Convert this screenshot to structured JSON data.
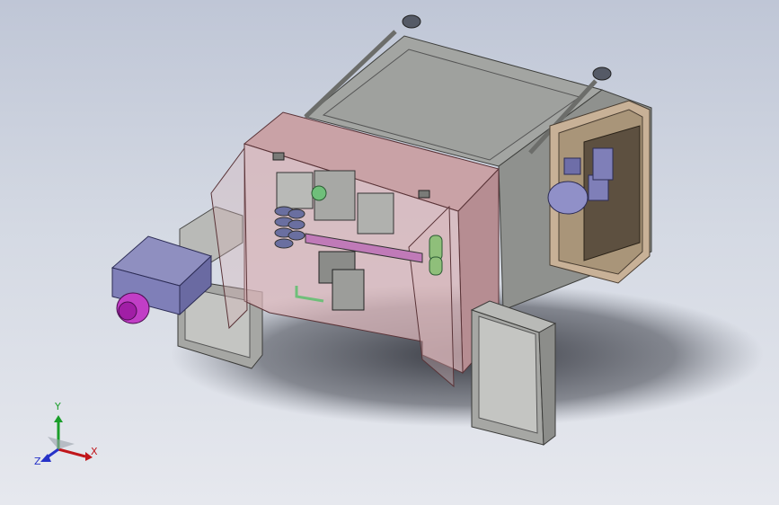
{
  "viewport": {
    "background_top": "#bfc6d6",
    "background_bottom": "#e6e8ee"
  },
  "triad": {
    "x_label": "X",
    "y_label": "Y",
    "z_label": "Z",
    "x_color": "#c0161b",
    "y_color": "#1a9e2a",
    "z_color": "#2632c8"
  },
  "model": {
    "frame_color": "#8f918e",
    "front_panel_color": "#c9a2a6",
    "side_box_color": "#c8b197",
    "motor_color": "#7f7fb8",
    "motor_cap_color": "#c13ec6",
    "foot_color": "#a6a7a4"
  }
}
